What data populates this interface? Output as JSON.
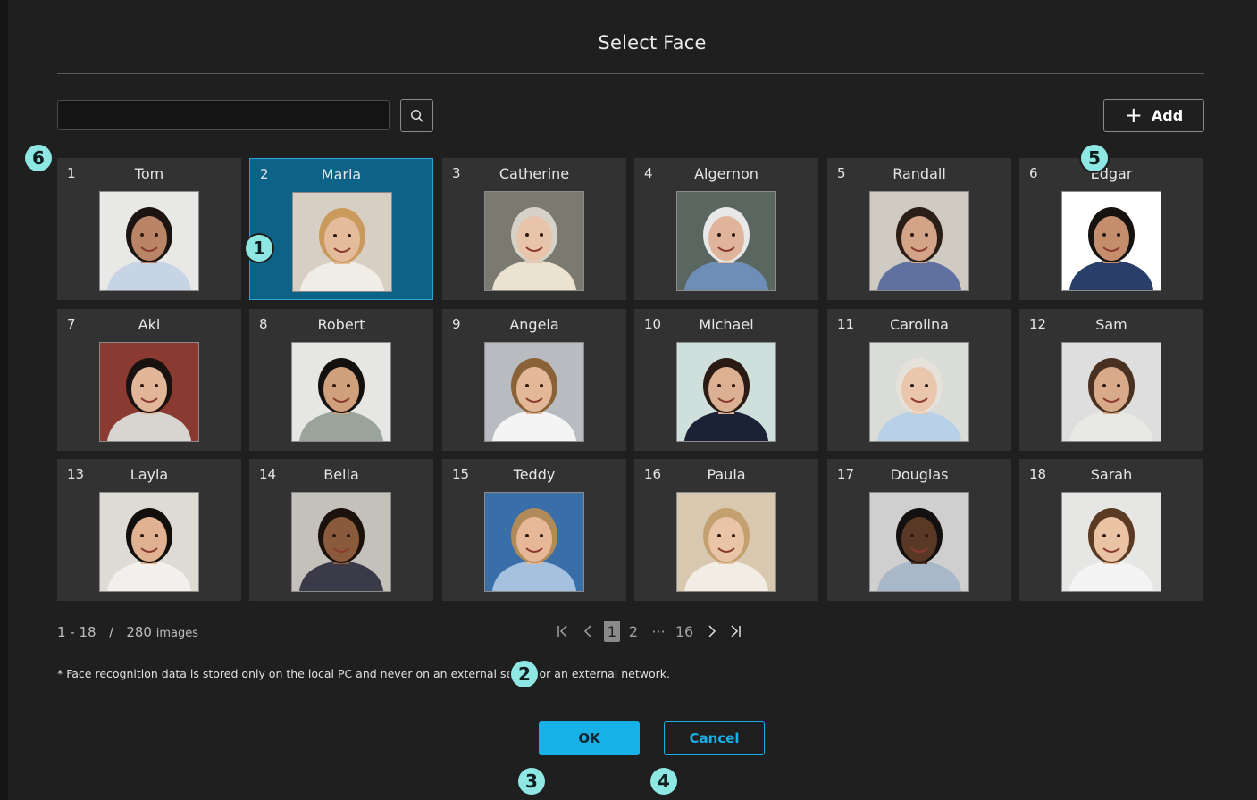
{
  "dialog": {
    "title": "Select Face"
  },
  "search": {
    "value": "",
    "placeholder": "",
    "button_icon": "search-icon"
  },
  "add_button": {
    "label": "Add",
    "icon": "plus-icon"
  },
  "faces": [
    {
      "num": "1",
      "name": "Tom",
      "skin": "#b98566",
      "hair": "#1c1410",
      "bg": "#e8e8e6",
      "shirt": "#c7d4e6",
      "selected": false
    },
    {
      "num": "2",
      "name": "Maria",
      "skin": "#e4bc9c",
      "hair": "#c99a5b",
      "bg": "#d8cfc4",
      "shirt": "#f0ece6",
      "selected": true
    },
    {
      "num": "3",
      "name": "Catherine",
      "skin": "#e8c4aa",
      "hair": "#d6d2c8",
      "bg": "#7a7a70",
      "shirt": "#ebe2cf",
      "selected": false
    },
    {
      "num": "4",
      "name": "Algernon",
      "skin": "#e0b49a",
      "hair": "#e8e8e8",
      "bg": "#5a6660",
      "shirt": "#6e8eb8",
      "selected": false
    },
    {
      "num": "5",
      "name": "Randall",
      "skin": "#d4a488",
      "hair": "#2a1e16",
      "bg": "#cfcac2",
      "shirt": "#6070a0",
      "selected": false
    },
    {
      "num": "6",
      "name": "Edgar",
      "skin": "#c48e6c",
      "hair": "#161210",
      "bg": "#ffffff",
      "shirt": "#2a3e6a",
      "selected": false
    },
    {
      "num": "7",
      "name": "Aki",
      "skin": "#e2b698",
      "hair": "#1a1210",
      "bg": "#8a3a30",
      "shirt": "#d8d4d0",
      "selected": false
    },
    {
      "num": "8",
      "name": "Robert",
      "skin": "#d0a07c",
      "hair": "#141010",
      "bg": "#e6e6e4",
      "shirt": "#9ba49a",
      "selected": false
    },
    {
      "num": "9",
      "name": "Angela",
      "skin": "#e2b898",
      "hair": "#8a6238",
      "bg": "#b8bcc0",
      "shirt": "#f4f4f4",
      "selected": false
    },
    {
      "num": "10",
      "name": "Michael",
      "skin": "#dcb092",
      "hair": "#2a1c14",
      "bg": "#cfe0dc",
      "shirt": "#1c2236",
      "selected": false
    },
    {
      "num": "11",
      "name": "Carolina",
      "skin": "#eac6ac",
      "hair": "#e6e2da",
      "bg": "#dadcd8",
      "shirt": "#b8d0e8",
      "selected": false
    },
    {
      "num": "12",
      "name": "Sam",
      "skin": "#d8aa8a",
      "hair": "#4a3020",
      "bg": "#dedede",
      "shirt": "#e8e8e4",
      "selected": false
    },
    {
      "num": "13",
      "name": "Layla",
      "skin": "#e0b292",
      "hair": "#120e0c",
      "bg": "#dedad4",
      "shirt": "#f2f0ec",
      "selected": false
    },
    {
      "num": "14",
      "name": "Bella",
      "skin": "#8a5a3c",
      "hair": "#1c120c",
      "bg": "#c4c0ba",
      "shirt": "#3a3a48",
      "selected": false
    },
    {
      "num": "15",
      "name": "Teddy",
      "skin": "#e6b898",
      "hair": "#b08a58",
      "bg": "#3a6ea8",
      "shirt": "#a6c0e0",
      "selected": false
    },
    {
      "num": "16",
      "name": "Paula",
      "skin": "#eac4a6",
      "hair": "#c4a070",
      "bg": "#d8c8b0",
      "shirt": "#f2ede4",
      "selected": false
    },
    {
      "num": "17",
      "name": "Douglas",
      "skin": "#5a3826",
      "hair": "#141010",
      "bg": "#cfcfcf",
      "shirt": "#a8b8c8",
      "selected": false
    },
    {
      "num": "18",
      "name": "Sarah",
      "skin": "#eac2a4",
      "hair": "#5a3a22",
      "bg": "#e6e6e4",
      "shirt": "#f4f4f4",
      "selected": false
    }
  ],
  "pagination": {
    "range": "1 - 18",
    "separator": "/",
    "total": "280",
    "unit": "images",
    "pages": [
      "1",
      "2",
      "···",
      "16"
    ],
    "current_page": "1",
    "first_icon": "first-page-icon",
    "prev_icon": "chevron-left-icon",
    "next_icon": "chevron-right-icon",
    "last_icon": "last-page-icon"
  },
  "note": "* Face recognition data is stored only on the local PC and never on an external server or an external network.",
  "buttons": {
    "ok": "OK",
    "cancel": "Cancel"
  },
  "markers": [
    "1",
    "2",
    "3",
    "4",
    "5",
    "6"
  ],
  "colors": {
    "accent": "#16b1e6",
    "selected_card": "#0d6287",
    "marker": "#8ee7e3",
    "background": "#1f1f1f",
    "card": "#323232"
  }
}
